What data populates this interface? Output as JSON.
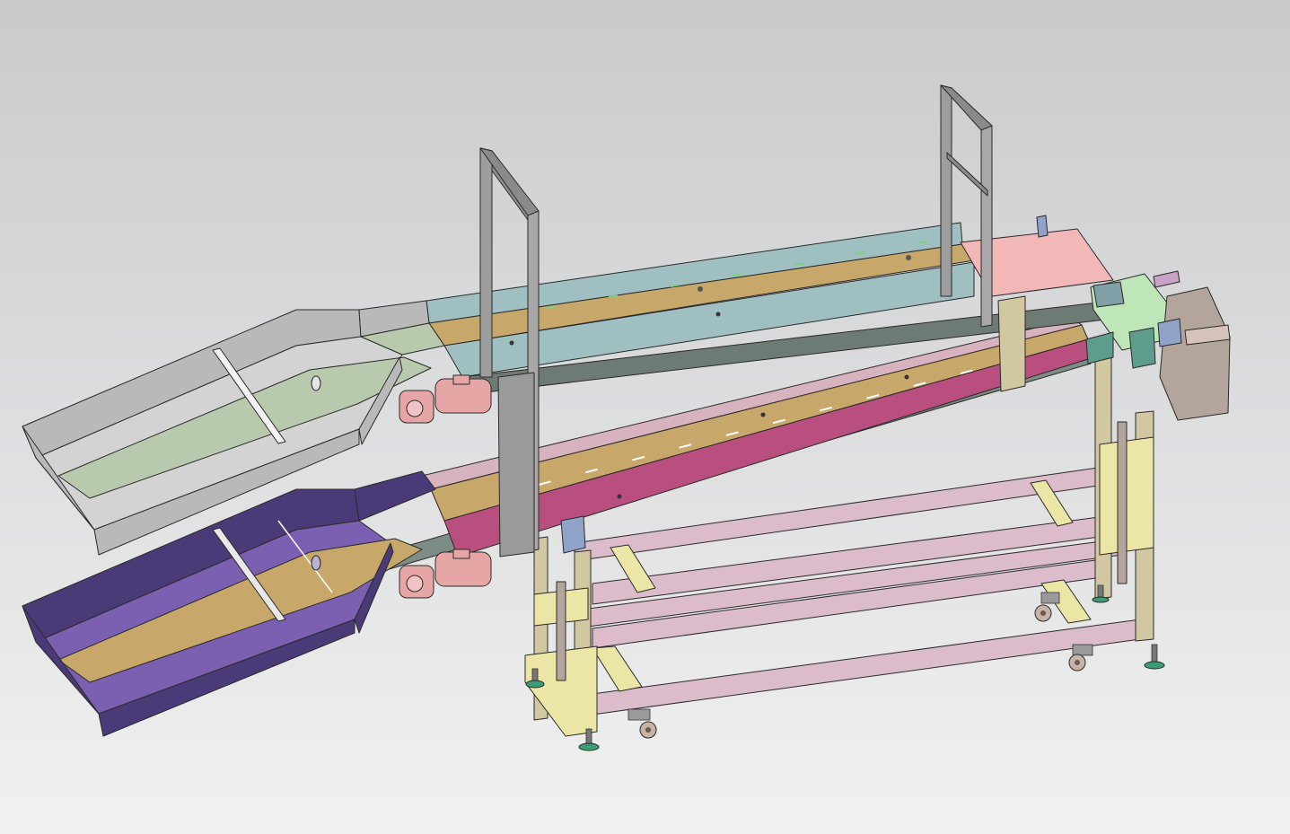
{
  "scene": {
    "background_top": "#c9cacc",
    "background_bottom": "#f1f1f1"
  },
  "colors": {
    "hopper_upper": "#b9b9b9",
    "hopper_upper_floor": "#d3d3d3",
    "hopper_upper_belt": "#b9c9ad",
    "hopper_lower": "#4b3a78",
    "hopper_lower_floor": "#7b5fb0",
    "belt_tan": "#c7a86a",
    "sidewall_teal": "#9fbfc0",
    "belt_rose": "#b84f7e",
    "sidewall_mauve": "#d7b3c0",
    "head_pink": "#f2b7b7",
    "head_green": "#bfe6b8",
    "frame_pink": "#dcbccb",
    "frame_yellow": "#ece6a6",
    "frame_post": "#d1c7a0",
    "motor": "#e6a6a6",
    "bin": "#b3a59b",
    "bracket_gray": "#9a9a9a",
    "foot": "#3b9c76"
  },
  "icons": [
    "motor-icon",
    "caster-wheel-icon",
    "leveling-foot-icon"
  ]
}
